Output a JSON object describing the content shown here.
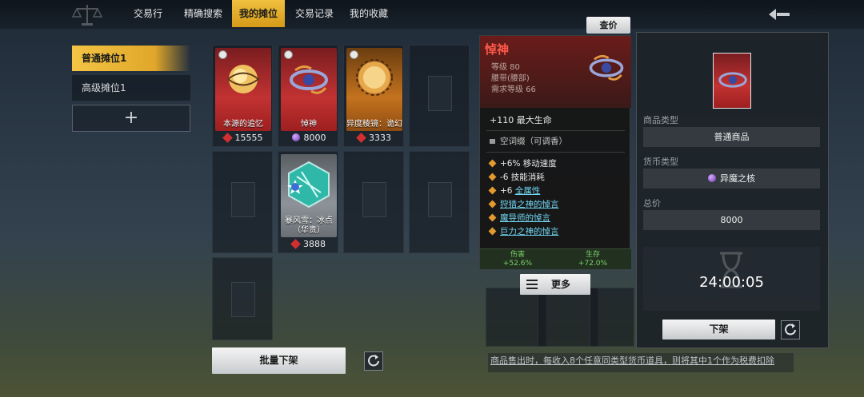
{
  "nav": {
    "tabs": [
      {
        "label": "交易行"
      },
      {
        "label": "精确搜索"
      },
      {
        "label": "我的摊位"
      },
      {
        "label": "交易记录"
      },
      {
        "label": "我的收藏"
      }
    ],
    "active_tab": "我的摊位"
  },
  "sidebar": {
    "slots": [
      {
        "label": "普通摊位1",
        "active": true
      },
      {
        "label": "高级摊位1",
        "active": false
      }
    ],
    "add_label": "+"
  },
  "grid": {
    "items": [
      {
        "name": "本源的追忆",
        "price": "15555",
        "currency": "red-crystal",
        "rarity": "red"
      },
      {
        "name": "悼神",
        "price": "8000",
        "currency": "purple-core",
        "rarity": "red"
      },
      {
        "name": "异度棱镜：诡幻",
        "price": "3333",
        "currency": "red-crystal",
        "rarity": "orange"
      },
      {
        "name": "暴风雪：冰点（华贵）",
        "price": "3888",
        "currency": "red-crystal",
        "rarity": "grey"
      }
    ]
  },
  "bulk_delist_label": "批量下架",
  "check_price_label": "查价",
  "tooltip": {
    "title": "悼神",
    "level": "等级 80",
    "slot": "腰带(腰部)",
    "req_level": "需求等级 66",
    "main_stat": "+110 最大生命",
    "socket": "空词缀（可调香）",
    "affixes": [
      {
        "text": "+6% 移动速度",
        "link": false
      },
      {
        "text": "-6 技能消耗",
        "link": false
      },
      {
        "prefix": "+6 ",
        "text": "全属性",
        "link": true
      },
      {
        "text": "狩猎之神的悼言",
        "link": true
      },
      {
        "text": "魔导师的悼言",
        "link": true
      },
      {
        "text": "巨力之神的悼言",
        "link": true
      }
    ],
    "footer": {
      "left_label": "伤害",
      "left_value": "+52.6%",
      "right_label": "生存",
      "right_value": "+72.0%"
    },
    "more_label": "更多"
  },
  "detail": {
    "product_type_label": "商品类型",
    "product_type_value": "普通商品",
    "currency_type_label": "货币类型",
    "currency_type_value": "异魔之核",
    "total_label": "总价",
    "total_value": "8000",
    "timer": "24:00:05",
    "delist_label": "下架"
  },
  "notice": "商品售出时，每收入8个任意同类型货币道具，则将其中1个作为税费扣除",
  "colors": {
    "accent_gold": "#f0c040",
    "rarity_red": "#c23232",
    "rarity_orange": "#c4731e",
    "link_cyan": "#6fd4ef",
    "stat_green": "#7ad36a"
  }
}
